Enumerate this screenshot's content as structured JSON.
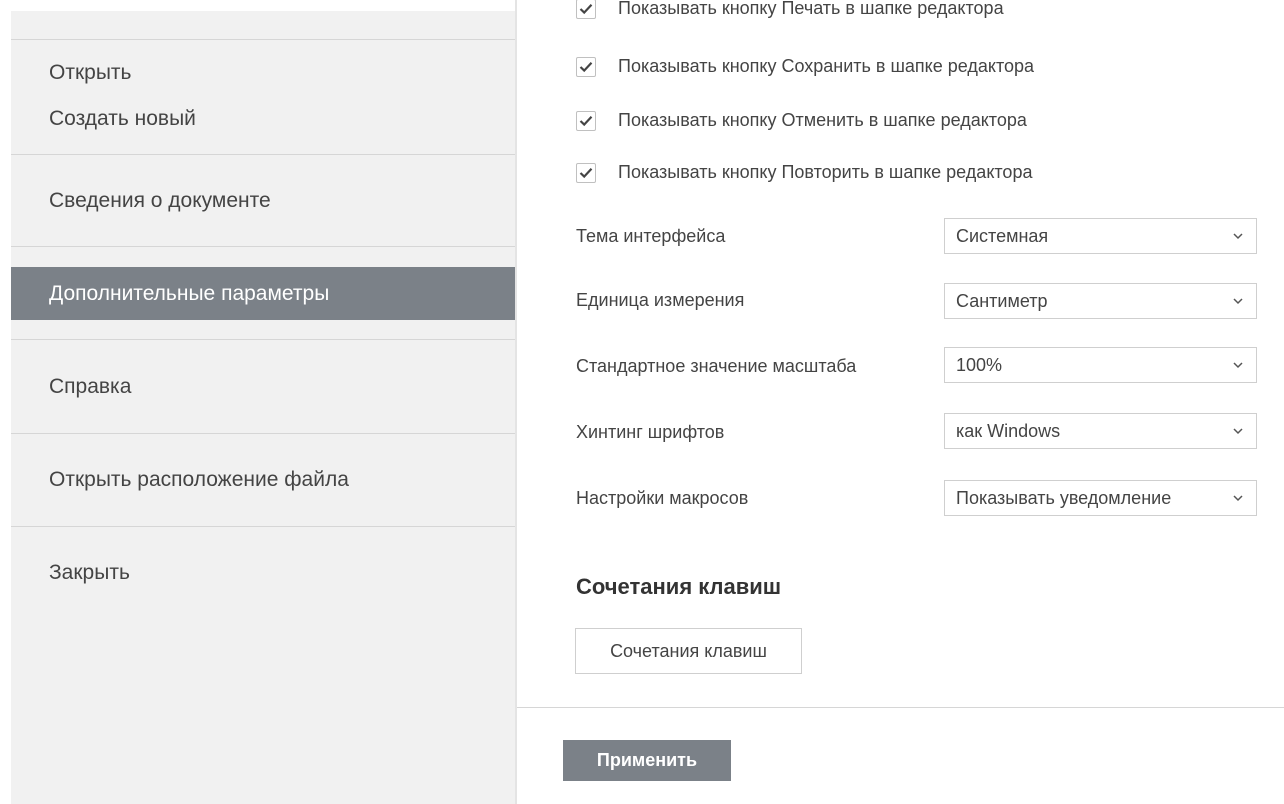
{
  "sidebar": {
    "items": [
      {
        "label": "Открыть"
      },
      {
        "label": "Создать новый"
      },
      {
        "label": "Сведения о документе"
      },
      {
        "label": "Дополнительные параметры"
      },
      {
        "label": "Справка"
      },
      {
        "label": "Открыть расположение файла"
      },
      {
        "label": "Закрыть"
      }
    ],
    "active_index": 3,
    "active_color": "#7b8188"
  },
  "settings": {
    "checkboxes": [
      {
        "label": "Показывать кнопку Печать в шапке редактора",
        "checked": true
      },
      {
        "label": "Показывать кнопку Сохранить в шапке редактора",
        "checked": true
      },
      {
        "label": "Показывать кнопку Отменить в шапке редактора",
        "checked": true
      },
      {
        "label": "Показывать кнопку Повторить в шапке редактора",
        "checked": true
      }
    ],
    "selects": [
      {
        "label": "Тема интерфейса",
        "value": "Системная"
      },
      {
        "label": "Единица измерения",
        "value": "Сантиметр"
      },
      {
        "label": "Стандартное значение масштаба",
        "value": "100%"
      },
      {
        "label": "Хинтинг шрифтов",
        "value": "как Windows"
      },
      {
        "label": "Настройки макросов",
        "value": "Показывать уведомление"
      }
    ]
  },
  "shortcuts": {
    "heading": "Сочетания клавиш",
    "button_label": "Сочетания клавиш"
  },
  "footer": {
    "apply_label": "Применить",
    "apply_color": "#7b8188"
  },
  "icons": {
    "checkmark": "check-icon",
    "dropdown": "chevron-down-icon"
  }
}
